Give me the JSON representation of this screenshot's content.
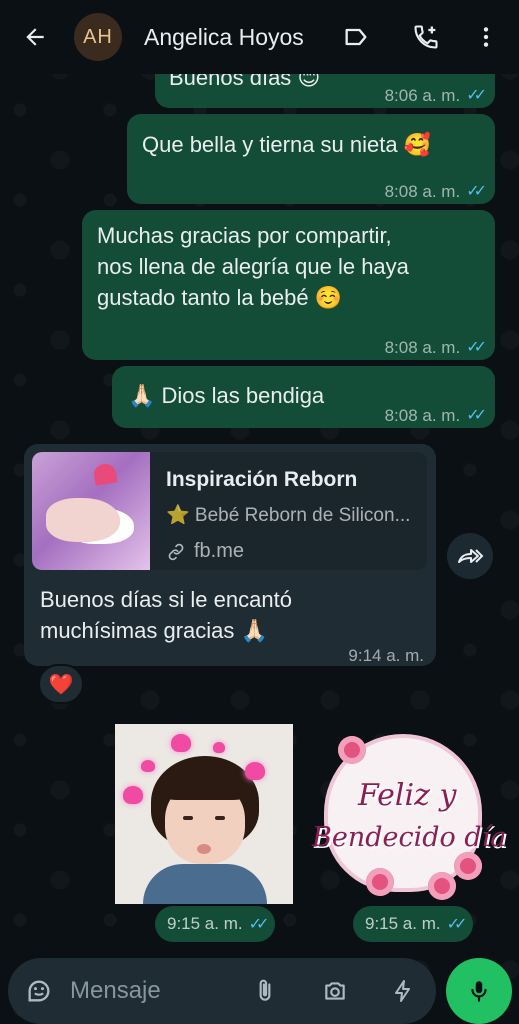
{
  "header": {
    "avatar_initials": "AH",
    "contact_name": "Angelica Hoyos"
  },
  "messages": [
    {
      "type": "out",
      "text": "Buenos días 😊",
      "time": "8:06 a. m."
    },
    {
      "type": "out",
      "text": "Que bella y tierna su nieta 🥰",
      "time": "8:08 a. m."
    },
    {
      "type": "out",
      "lines": [
        "Muchas gracias por compartir,",
        "nos llena de alegría que le haya",
        "gustado tanto la bebé ☺️"
      ],
      "time": "8:08 a. m."
    },
    {
      "type": "out",
      "text": "🙏🏻 Dios las bendiga",
      "time": "8:08 a. m."
    },
    {
      "type": "in",
      "preview": {
        "title": "Inspiración Reborn",
        "description": "⭐ Bebé Reborn de Silicon...",
        "link": "fb.me"
      },
      "lines": [
        "Buenos días si le encantó",
        "muchísimas gracias 🙏🏻"
      ],
      "time": "9:14 a. m.",
      "reaction": "❤️"
    },
    {
      "type": "sticker-out",
      "name": "kid-photo",
      "time": "9:15 a. m."
    },
    {
      "type": "sticker-out",
      "name": "greeting-card",
      "card_lines": [
        "Feliz y",
        "Bendecido día"
      ],
      "time": "9:15 a. m."
    }
  ],
  "input": {
    "placeholder": "Mensaje"
  },
  "colors": {
    "outgoing_bubble": "#134d37",
    "incoming_bubble": "#1f2c34",
    "read_ticks": "#53bdeb",
    "mic_button": "#21c063",
    "background": "#0b1014"
  },
  "icons": [
    "back-arrow-icon",
    "label-icon",
    "add-call-icon",
    "more-vert-icon",
    "forward-icon",
    "link-icon",
    "sticker-icon",
    "attach-icon",
    "camera-icon",
    "bolt-icon",
    "mic-icon"
  ]
}
